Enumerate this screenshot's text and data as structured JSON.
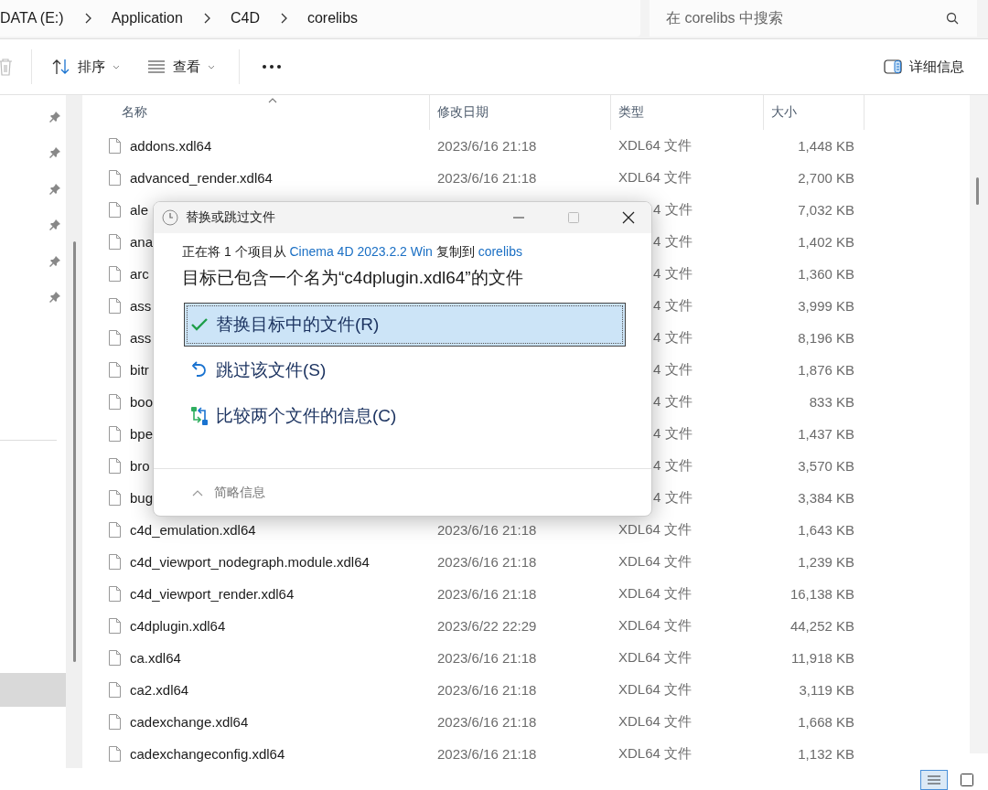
{
  "breadcrumb": [
    "DATA (E:)",
    "Application",
    "C4D",
    "corelibs"
  ],
  "search": {
    "placeholder": "在 corelibs 中搜索"
  },
  "toolbar": {
    "sort": "排序",
    "view": "查看",
    "details": "详细信息"
  },
  "nav": {
    "pinned_items": [
      {
        "pinned": true
      },
      {
        "pinned": true
      },
      {
        "pinned": true
      },
      {
        "pinned": true
      },
      {
        "pinned": true
      },
      {
        "pinned": true
      }
    ],
    "lower_items": [
      {
        "selected": false
      },
      {
        "selected": false
      },
      {
        "selected": false
      },
      {
        "selected": false
      },
      {
        "selected": false
      },
      {
        "selected": false
      },
      {
        "selected": true
      }
    ]
  },
  "table": {
    "columns": [
      {
        "label": "名称",
        "sorted": true
      },
      {
        "label": "修改日期",
        "sorted": false
      },
      {
        "label": "类型",
        "sorted": false
      },
      {
        "label": "大小",
        "sorted": false
      }
    ],
    "rows": [
      {
        "name": "addons.xdl64",
        "date": "2023/6/16 21:18",
        "type": "XDL64 文件",
        "size": "1,448 KB",
        "covered": false
      },
      {
        "name": "advanced_render.xdl64",
        "date": "2023/6/16 21:18",
        "type": "XDL64 文件",
        "size": "2,700 KB",
        "covered": false
      },
      {
        "name": "ale",
        "type": "4 文件",
        "size": "7,032 KB",
        "covered": true
      },
      {
        "name": "ana",
        "type": "4 文件",
        "size": "1,402 KB",
        "covered": true
      },
      {
        "name": "arc",
        "type": "4 文件",
        "size": "1,360 KB",
        "covered": true
      },
      {
        "name": "ass",
        "type": "4 文件",
        "size": "3,999 KB",
        "covered": true
      },
      {
        "name": "ass",
        "type": "4 文件",
        "size": "8,196 KB",
        "covered": true
      },
      {
        "name": "bitr",
        "type": "4 文件",
        "size": "1,876 KB",
        "covered": true
      },
      {
        "name": "boo",
        "type": "4 文件",
        "size": "833 KB",
        "covered": true
      },
      {
        "name": "bpe",
        "type": "4 文件",
        "size": "1,437 KB",
        "covered": true
      },
      {
        "name": "bro",
        "type": "4 文件",
        "size": "3,570 KB",
        "covered": true
      },
      {
        "name": "bug",
        "type": "4 文件",
        "size": "3,384 KB",
        "covered": true
      },
      {
        "name": "c4d_emulation.xdl64",
        "date": "2023/6/16 21:18",
        "type": "XDL64 文件",
        "size": "1,643 KB",
        "covered": false
      },
      {
        "name": "c4d_viewport_nodegraph.module.xdl64",
        "date": "2023/6/16 21:18",
        "type": "XDL64 文件",
        "size": "1,239 KB",
        "covered": false
      },
      {
        "name": "c4d_viewport_render.xdl64",
        "date": "2023/6/16 21:18",
        "type": "XDL64 文件",
        "size": "16,138 KB",
        "covered": false
      },
      {
        "name": "c4dplugin.xdl64",
        "date": "2023/6/22 22:29",
        "type": "XDL64 文件",
        "size": "44,252 KB",
        "covered": false
      },
      {
        "name": "ca.xdl64",
        "date": "2023/6/16 21:18",
        "type": "XDL64 文件",
        "size": "11,918 KB",
        "covered": false
      },
      {
        "name": "ca2.xdl64",
        "date": "2023/6/16 21:18",
        "type": "XDL64 文件",
        "size": "3,119 KB",
        "covered": false
      },
      {
        "name": "cadexchange.xdl64",
        "date": "2023/6/16 21:18",
        "type": "XDL64 文件",
        "size": "1,668 KB",
        "covered": false
      },
      {
        "name": "cadexchangeconfig.xdl64",
        "date": "2023/6/16 21:18",
        "type": "XDL64 文件",
        "size": "1,132 KB",
        "covered": false
      }
    ]
  },
  "dialog": {
    "title": "替换或跳过文件",
    "message": [
      {
        "text": "正在将 1 个项目从 ",
        "kind": "plain"
      },
      {
        "text": "Cinema 4D 2023.2.2 Win",
        "kind": "link"
      },
      {
        "text": " 复制到 ",
        "kind": "plain"
      },
      {
        "text": "corelibs",
        "kind": "link"
      }
    ],
    "heading": "目标已包含一个名为“c4dplugin.xdl64”的文件",
    "options": [
      {
        "label": "替换目标中的文件(R)",
        "kind": "replace",
        "selected": true
      },
      {
        "label": "跳过该文件(S)",
        "kind": "skip",
        "selected": false
      },
      {
        "label": "比较两个文件的信息(C)",
        "kind": "compare",
        "selected": false
      }
    ],
    "footer": "简略信息"
  },
  "view_buttons": [
    {
      "kind": "details",
      "selected": true
    },
    {
      "kind": "tiles",
      "selected": false
    }
  ]
}
